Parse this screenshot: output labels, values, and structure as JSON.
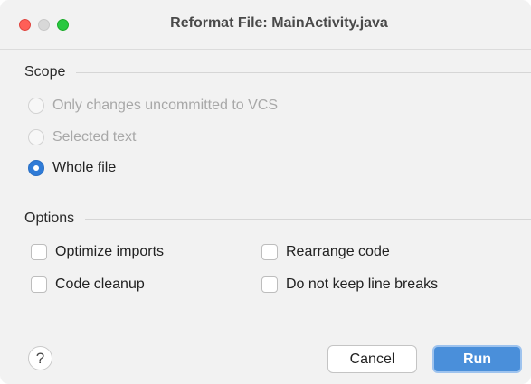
{
  "window": {
    "title": "Reformat File: MainActivity.java"
  },
  "scope": {
    "header": "Scope",
    "options": [
      {
        "label": "Only changes uncommitted to VCS",
        "selected": false,
        "enabled": false
      },
      {
        "label": "Selected text",
        "selected": false,
        "enabled": false
      },
      {
        "label": "Whole file",
        "selected": true,
        "enabled": true
      }
    ]
  },
  "options": {
    "header": "Options",
    "checkboxes": [
      {
        "label": "Optimize imports",
        "checked": false
      },
      {
        "label": "Rearrange code",
        "checked": false
      },
      {
        "label": "Code cleanup",
        "checked": false
      },
      {
        "label": "Do not keep line breaks",
        "checked": false
      }
    ]
  },
  "footer": {
    "help_label": "?",
    "cancel_label": "Cancel",
    "run_label": "Run"
  },
  "colors": {
    "accent": "#4a8fda",
    "close": "#ff5f57",
    "maximize": "#28c840"
  }
}
